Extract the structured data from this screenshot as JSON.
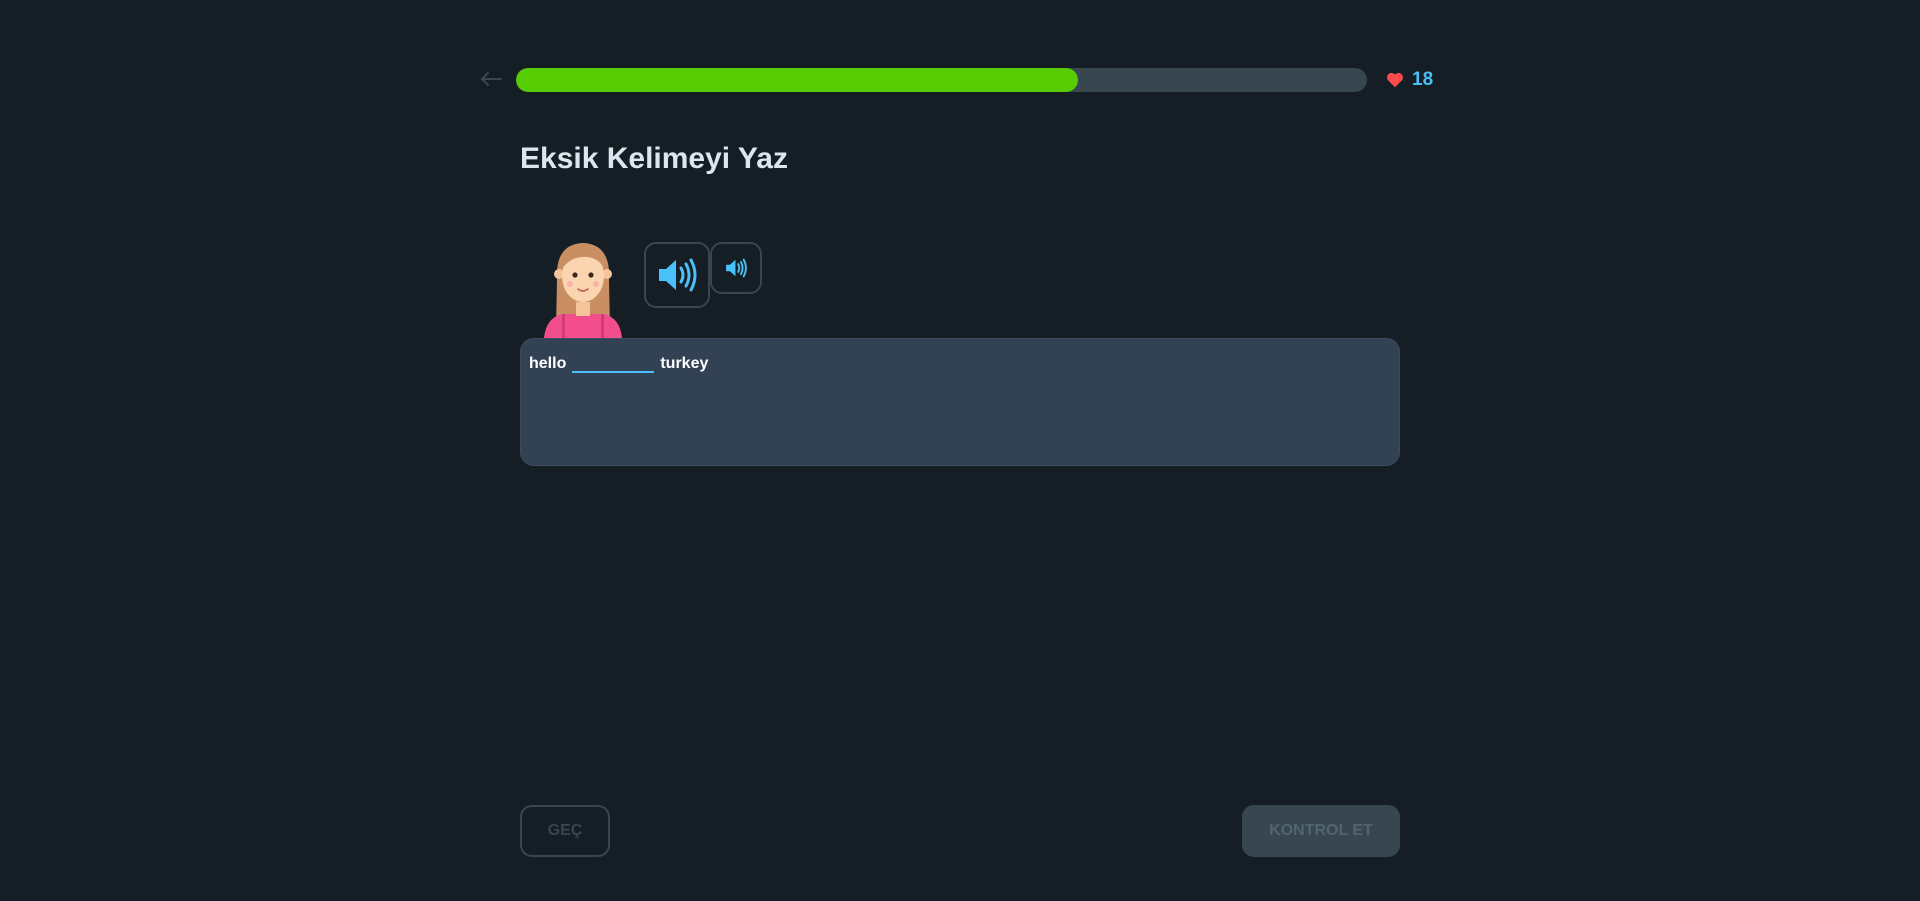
{
  "header": {
    "progress_fraction": 0.66,
    "hearts_count": "18"
  },
  "exercise": {
    "title": "Eksik Kelimeyi Yaz",
    "sentence_before": "hello",
    "sentence_after": "turkey",
    "blank_value": ""
  },
  "footer": {
    "skip_label": "GEÇ",
    "check_label": "KONTROL ET"
  },
  "colors": {
    "background": "#151e25",
    "progress_fill": "#58cc02",
    "progress_track": "#37464f",
    "heart": "#ff4b4b",
    "accent_blue": "#49c0f8",
    "sentence_box": "#334155"
  },
  "icons": {
    "back": "arrow-left-icon",
    "heart": "heart-icon",
    "audio": "speaker-icon",
    "audio_slow": "speaker-slow-icon"
  }
}
